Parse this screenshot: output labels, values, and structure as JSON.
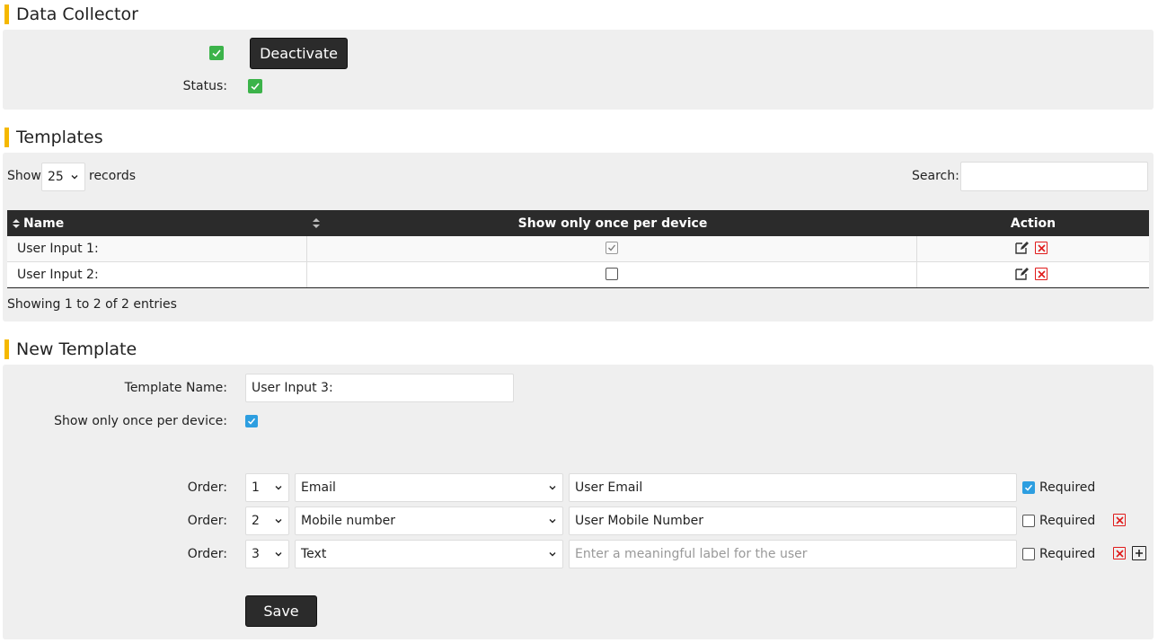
{
  "data_collector": {
    "title": "Data Collector",
    "activated": true,
    "deactivate_label": "Deactivate",
    "status_label": "Status:",
    "status": true
  },
  "templates": {
    "title": "Templates",
    "show_label": "Show",
    "records_label": "records",
    "page_size": "25",
    "search_label": "Search:",
    "search_value": "",
    "columns": [
      "Name",
      "Show only once per device",
      "Action"
    ],
    "rows": [
      {
        "name": "User Input 1:",
        "once": true
      },
      {
        "name": "User Input 2:",
        "once": false
      }
    ],
    "info": "Showing 1 to 2 of 2 entries"
  },
  "new_template": {
    "title": "New Template",
    "name_label": "Template Name:",
    "name_value": "User Input 3:",
    "once_label": "Show only once per device:",
    "once_checked": true,
    "order_label": "Order:",
    "required_label": "Required",
    "fields": [
      {
        "order": "1",
        "type": "Email",
        "label_value": "User Email",
        "placeholder": "",
        "required": true
      },
      {
        "order": "2",
        "type": "Mobile number",
        "label_value": "User Mobile Number",
        "placeholder": "",
        "required": false
      },
      {
        "order": "3",
        "type": "Text",
        "label_value": "",
        "placeholder": "Enter a meaningful label for the user",
        "required": false
      }
    ],
    "save_label": "Save"
  },
  "colors": {
    "accent": "#f5b800",
    "panel": "#efefef",
    "header_dark": "#2b2b2b",
    "check_green": "#3cb34a",
    "check_blue": "#2d9ee0",
    "delete_red": "#e01b1b"
  }
}
